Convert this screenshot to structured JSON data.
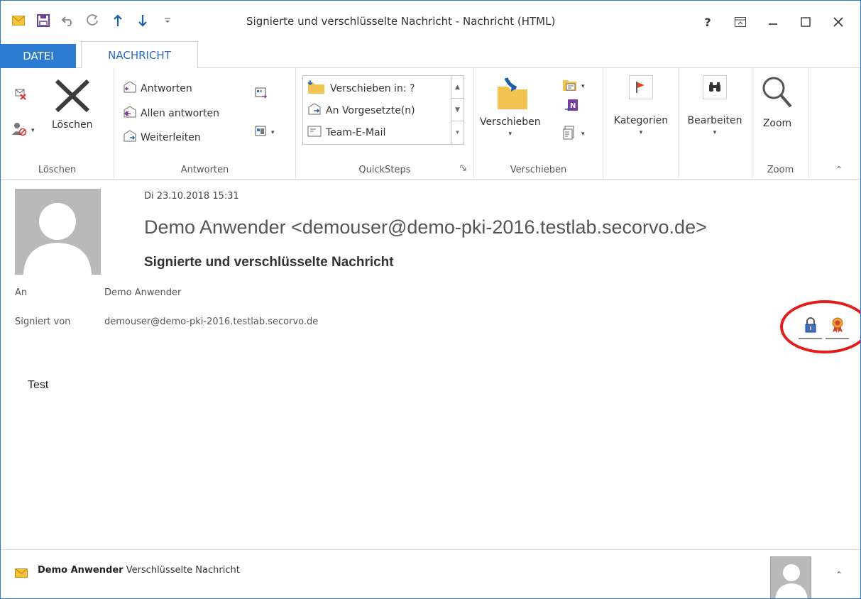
{
  "window": {
    "title": "Signierte und verschlüsselte  Nachricht - Nachricht (HTML)",
    "help": "?",
    "controls": {
      "ribbon_options": "⧈",
      "minimize": "—",
      "maximize": "☐",
      "close": "✕"
    }
  },
  "tabs": [
    {
      "label": "DATEI",
      "active": false
    },
    {
      "label": "NACHRICHT",
      "active": true
    }
  ],
  "ribbon": {
    "loeschen": {
      "delete_label": "Löschen",
      "group_label": "Löschen"
    },
    "antworten": {
      "reply": "Antworten",
      "reply_all": "Allen antworten",
      "forward": "Weiterleiten",
      "group_label": "Antworten"
    },
    "quicksteps": {
      "items": [
        "Verschieben in: ?",
        "An Vorgesetzte(n)",
        "Team-E-Mail"
      ],
      "group_label": "QuickSteps"
    },
    "verschieben": {
      "move_label": "Verschieben",
      "group_label": "Verschieben"
    },
    "kategorien": {
      "label": "Kategorien"
    },
    "bearbeiten": {
      "label": "Bearbeiten"
    },
    "zoom": {
      "label": "Zoom",
      "group_label": "Zoom"
    }
  },
  "message": {
    "date": "Di 23.10.2018 15:31",
    "sender": "Demo Anwender <demouser@demo-pki-2016.testlab.secorvo.de>",
    "subject": "Signierte und verschlüsselte  Nachricht",
    "to_label": "An",
    "to_value": "Demo Anwender",
    "signed_label": "Signiert von",
    "signed_value": "demouser@demo-pki-2016.testlab.secorvo.de",
    "body": "Test"
  },
  "people_pane": {
    "name": "Demo Anwender",
    "status": "Verschlüsselte Nachricht"
  },
  "colors": {
    "accent": "#2b7bd1",
    "highlight_circle": "#e31b1b"
  }
}
